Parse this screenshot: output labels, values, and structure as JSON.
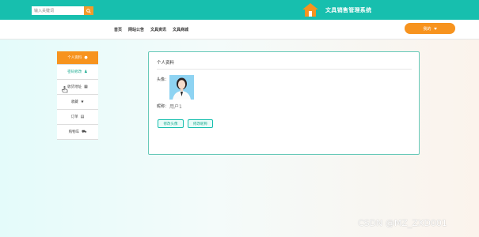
{
  "header": {
    "search": {
      "placeholder": "输入关键词",
      "value": ""
    },
    "app_title": "文具销售管理系统"
  },
  "nav": {
    "items": [
      "首页",
      "网站公告",
      "文具资讯",
      "文具商城"
    ]
  },
  "user_button": {
    "label": "我的"
  },
  "sidebar": {
    "items": [
      {
        "label": "个人资料",
        "icon": "user-icon"
      },
      {
        "label": "密码修改",
        "icon": "user-icon"
      },
      {
        "label": "收货地址",
        "icon": "grid-icon"
      },
      {
        "label": "收藏",
        "icon": "star-icon"
      },
      {
        "label": "订单",
        "icon": "list-icon"
      },
      {
        "label": "购物车",
        "icon": "cart-icon"
      }
    ]
  },
  "profile": {
    "title": "个人资料",
    "avatar_label": "头像：",
    "nickname_label": "昵称：",
    "nickname_value": "用户1",
    "buttons": {
      "edit_avatar": "修改头像",
      "edit_nickname": "修改昵称"
    }
  },
  "watermark": "CSDN @MZ_ZXD001",
  "colors": {
    "brand_teal": "#17bfae",
    "accent_orange": "#f7931e"
  }
}
